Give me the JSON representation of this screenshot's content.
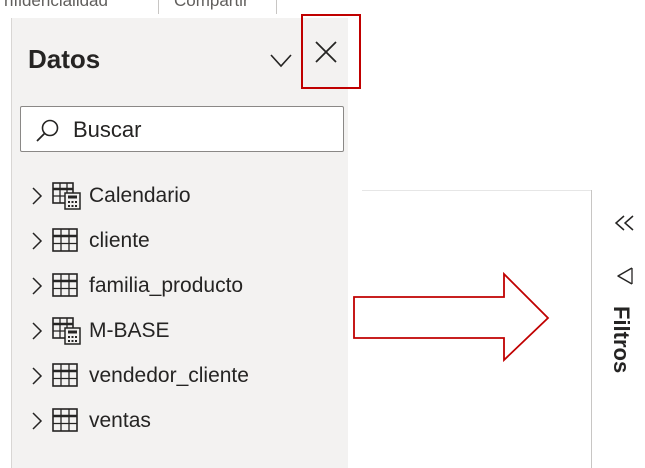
{
  "ribbon": {
    "tabs": [
      "nfidencialidad",
      "Compartir"
    ]
  },
  "data_pane": {
    "title": "Datos",
    "search_placeholder": "Buscar",
    "tables": [
      {
        "label": "Calendario",
        "icon": "calculated-table-icon"
      },
      {
        "label": "cliente",
        "icon": "table-icon"
      },
      {
        "label": "familia_producto",
        "icon": "table-icon"
      },
      {
        "label": "M-BASE",
        "icon": "calculated-table-icon"
      },
      {
        "label": "vendedor_cliente",
        "icon": "table-icon"
      },
      {
        "label": "ventas",
        "icon": "table-icon"
      }
    ]
  },
  "filters_pane": {
    "label": "Filtros"
  },
  "colors": {
    "highlight": "#c00000",
    "pane_background": "#f3f2f1"
  }
}
